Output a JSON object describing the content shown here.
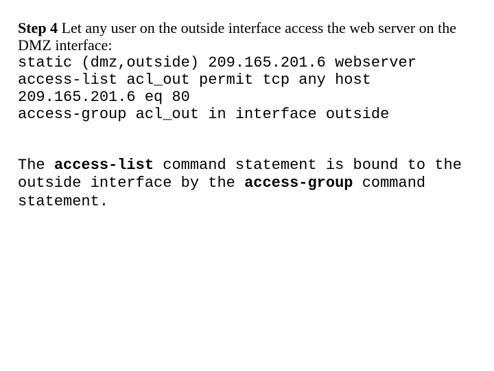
{
  "step": {
    "label": "Step 4",
    "intro_part1": " Let any user on the outside interface access the web server on the DMZ interface:"
  },
  "code": {
    "line1": "static (dmz,outside) 209.165.201.6 webserver",
    "line2": "access-list acl_out permit tcp any host 209.165.201.6 eq 80",
    "line3": "access-group acl_out in interface outside"
  },
  "explain": {
    "t1": "The ",
    "b1": "access-list",
    "t2": " command statement is bound to the outside interface by the ",
    "b2": "access-group",
    "t3": " command statement."
  }
}
